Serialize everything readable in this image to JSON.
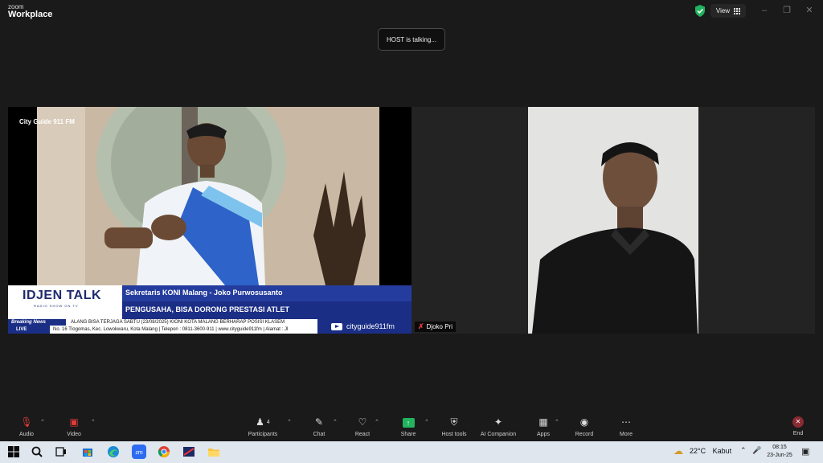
{
  "app": {
    "brand_top": "zoom",
    "brand_name": "Workplace"
  },
  "title_bar": {
    "view_label": "View"
  },
  "notification": {
    "text": "HOST is talking..."
  },
  "participants": {
    "left": {
      "name": "",
      "overlay": {
        "logo_text": "City Guide 911 FM",
        "show_title": "IDJEN TALK",
        "show_subtitle": "RADIO SHOW ON TV",
        "headline_top": "Sekretaris KONI Malang - Joko Purwosusanto",
        "headline_bottom": "PENGUSAHA, BISA DORONG PRESTASI ATLET",
        "breaking_label": "Breaking News",
        "ticker_1": "ALANG BISA TERJAGA      SABTU (23/08/2025) KIONI KOTA MALANG BERHARAP POSISI KLASEM",
        "live_label": "LIVE",
        "ticker_2": "No. 16 Tlogomas, Kec. Lowokwaru, Kota Malang | Telepon : 0811-3600-911 | www.cityguide911fm | Alamat : Jl",
        "channel": "cityguide911fm"
      }
    },
    "right": {
      "name": "Djoko Pri"
    }
  },
  "toolbar": {
    "audio": "Audio",
    "video": "Video",
    "participants": "Participants",
    "participants_count": "4",
    "chat": "Chat",
    "react": "React",
    "share": "Share",
    "host_tools": "Host tools",
    "ai_companion": "AI Companion",
    "apps": "Apps",
    "record": "Record",
    "more": "More",
    "end": "End"
  },
  "taskbar": {
    "weather_temp": "22°C",
    "weather_desc": "Kabut",
    "time": "08:15",
    "date": "23-Jun-25"
  },
  "colors": {
    "zoom_bg": "#1a1a1a",
    "broadcast_blue": "#1b2e86",
    "share_green": "#22b35e",
    "end_red": "#8a2a33",
    "mic_off_red": "#e23b3b"
  }
}
